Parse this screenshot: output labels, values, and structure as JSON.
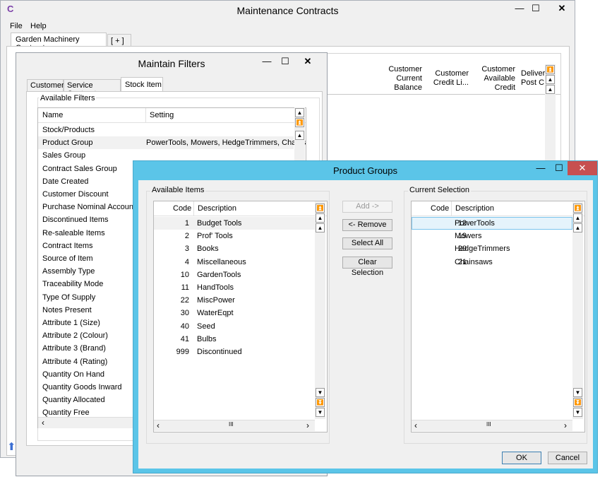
{
  "main_window": {
    "title": "Maintenance Contracts",
    "menu": [
      "File",
      "Help"
    ],
    "tabs": [
      "Garden Machinery Contracts",
      "[ + ]"
    ],
    "columns": [
      {
        "lines": [
          "Customer",
          "Current",
          "Balance"
        ]
      },
      {
        "lines": [
          "Customer",
          "Credit Li..."
        ]
      },
      {
        "lines": [
          "Customer",
          "Available",
          "Credit"
        ]
      },
      {
        "lines": [
          "Deliver",
          "Post C"
        ]
      }
    ]
  },
  "filters_window": {
    "title": "Maintain Filters",
    "tabs": [
      "Customer",
      "Service Contract",
      "Stock Item"
    ],
    "group_label": "Available Filters",
    "headers": {
      "name": "Name",
      "setting": "Setting"
    },
    "rows": [
      {
        "name": "Stock/Products",
        "setting": ""
      },
      {
        "name": "Product Group",
        "setting": "PowerTools, Mowers, HedgeTrimmers, Chainsaw"
      },
      {
        "name": "Sales Group",
        "setting": ""
      },
      {
        "name": "Contract Sales Group",
        "setting": ""
      },
      {
        "name": "Date Created",
        "setting": ""
      },
      {
        "name": "Customer Discount",
        "setting": ""
      },
      {
        "name": "Purchase Nominal Account",
        "setting": ""
      },
      {
        "name": "Discontinued Items",
        "setting": ""
      },
      {
        "name": "Re-saleable Items",
        "setting": ""
      },
      {
        "name": "Contract Items",
        "setting": ""
      },
      {
        "name": "Source of Item",
        "setting": ""
      },
      {
        "name": "Assembly Type",
        "setting": ""
      },
      {
        "name": "Traceability Mode",
        "setting": ""
      },
      {
        "name": "Type Of Supply",
        "setting": ""
      },
      {
        "name": "Notes Present",
        "setting": ""
      },
      {
        "name": "Attribute 1 (Size)",
        "setting": ""
      },
      {
        "name": "Attribute 2 (Colour)",
        "setting": ""
      },
      {
        "name": "Attribute 3 (Brand)",
        "setting": ""
      },
      {
        "name": "Attribute 4 (Rating)",
        "setting": ""
      },
      {
        "name": "Quantity On Hand",
        "setting": ""
      },
      {
        "name": "Quantity Goods Inward",
        "setting": ""
      },
      {
        "name": "Quantity Allocated",
        "setting": ""
      },
      {
        "name": "Quantity Free",
        "setting": ""
      }
    ]
  },
  "product_groups": {
    "title": "Product Groups",
    "available_label": "Available Items",
    "selection_label": "Current Selection",
    "headers": {
      "code": "Code",
      "description": "Description"
    },
    "available_items": [
      {
        "code": "1",
        "description": "Budget Tools"
      },
      {
        "code": "2",
        "description": "Prof' Tools"
      },
      {
        "code": "3",
        "description": "Books"
      },
      {
        "code": "4",
        "description": "Miscellaneous"
      },
      {
        "code": "10",
        "description": "GardenTools"
      },
      {
        "code": "11",
        "description": "HandTools"
      },
      {
        "code": "22",
        "description": "MiscPower"
      },
      {
        "code": "30",
        "description": "WaterEqpt"
      },
      {
        "code": "40",
        "description": "Seed"
      },
      {
        "code": "41",
        "description": "Bulbs"
      },
      {
        "code": "999",
        "description": "Discontinued"
      }
    ],
    "current_selection": [
      {
        "code": "12",
        "description": "PowerTools"
      },
      {
        "code": "19",
        "description": "Mowers"
      },
      {
        "code": "20",
        "description": "HedgeTrimmers"
      },
      {
        "code": "21",
        "description": "Chainsaws"
      }
    ],
    "buttons": {
      "add": "Add ->",
      "remove": "<- Remove",
      "select_all": "Select All",
      "clear": "Clear Selection",
      "ok": "OK",
      "cancel": "Cancel"
    },
    "accent_color": "#5bc5e8"
  },
  "window_controls": {
    "minimize": "—",
    "maximize": "☐",
    "close": "✕"
  },
  "scroll_glyphs": {
    "up": "▲",
    "down": "▼",
    "top": "⏫",
    "bottom": "⏬",
    "left": "‹",
    "right": "›",
    "grip": "III"
  }
}
